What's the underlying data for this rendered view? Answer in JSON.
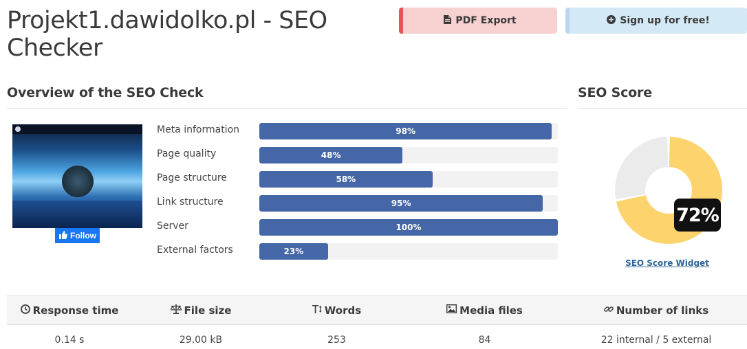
{
  "header": {
    "title": "Projekt1.dawidolko.pl - SEO Checker",
    "pdf_label": "PDF Export",
    "signup_label": "Sign up for free!"
  },
  "overview": {
    "title": "Overview of the SEO Check",
    "follow_label": "Follow",
    "metrics": [
      {
        "label": "Meta information",
        "percent": 98,
        "text": "98%"
      },
      {
        "label": "Page quality",
        "percent": 48,
        "text": "48%"
      },
      {
        "label": "Page structure",
        "percent": 58,
        "text": "58%"
      },
      {
        "label": "Link structure",
        "percent": 95,
        "text": "95%"
      },
      {
        "label": "Server",
        "percent": 100,
        "text": "100%"
      },
      {
        "label": "External factors",
        "percent": 23,
        "text": "23%"
      }
    ]
  },
  "score": {
    "title": "SEO Score",
    "value": 72,
    "text": "72%",
    "widget_link": "SEO Score Widget",
    "fill_color": "#fdd36e",
    "rest_color": "#ebebeb"
  },
  "stats": {
    "headers": [
      "Response time",
      "File size",
      "Words",
      "Media files",
      "Number of links"
    ],
    "values": [
      "0.14 s",
      "29.00 kB",
      "253",
      "84",
      "22 internal / 5 external"
    ],
    "icons": [
      "clock-icon",
      "scale-icon",
      "text-height-icon",
      "image-icon",
      "link-icon"
    ]
  },
  "colors": {
    "bar_fill": "#4567a8",
    "bar_track": "#f2f2f2",
    "pdf_accent": "#e05555",
    "pdf_bg": "#f7d0d0",
    "signup_bg": "#d4e9f6",
    "facebook": "#1877f2"
  }
}
